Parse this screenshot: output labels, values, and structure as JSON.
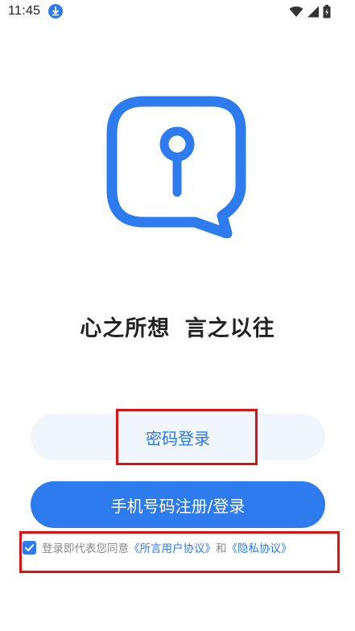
{
  "status_bar": {
    "time": "11:45",
    "icons": [
      "download-icon",
      "wifi-icon",
      "signal-icon",
      "battery-charging-icon"
    ]
  },
  "logo": {
    "icon": "keyhole-chat-bubble-logo"
  },
  "slogan": "心之所想 言之以往",
  "password_login": {
    "label": "密码登录"
  },
  "phone_login": {
    "label": "手机号码注册/登录"
  },
  "agreement": {
    "checked": true,
    "prefix": "登录即代表您同意",
    "user_agreement": "《所言用户协议》",
    "conjunction": "和",
    "privacy_agreement": "《隐私协议》"
  },
  "colors": {
    "primary": "#2e7bf0",
    "light_button_bg": "#f1f5fc",
    "highlight": "#e01010",
    "text_dark": "#222222",
    "text_muted": "#8a8a8a"
  }
}
